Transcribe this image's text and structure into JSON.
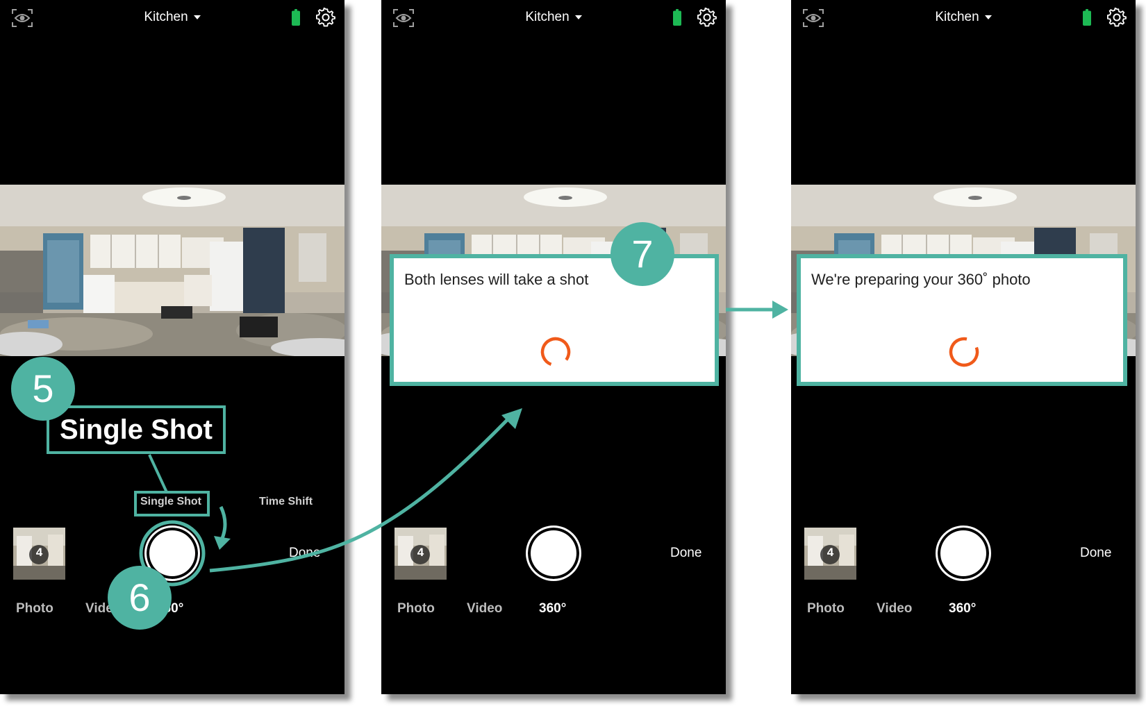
{
  "screens": [
    {
      "location": "Kitchen",
      "thumbnail_count": "4",
      "done_label": "Done",
      "modes": [
        "Photo",
        "Video",
        "360°"
      ],
      "submodes": [
        "Single Shot",
        "Time Shift"
      ]
    },
    {
      "location": "Kitchen",
      "thumbnail_count": "4",
      "done_label": "Done",
      "modes": [
        "Photo",
        "Video",
        "360°"
      ],
      "dialog_text": "Both lenses will take a shot"
    },
    {
      "location": "Kitchen",
      "thumbnail_count": "4",
      "done_label": "Done",
      "modes": [
        "Photo",
        "Video",
        "360°"
      ],
      "dialog_text": "We're preparing your 360˚ photo"
    }
  ],
  "annotations": {
    "step5": "5",
    "step6": "6",
    "step7": "7",
    "callout_text": "Single Shot"
  },
  "colors": {
    "accent": "#4fb3a2",
    "battery": "#1db954",
    "spinner": "#f05a1a"
  }
}
